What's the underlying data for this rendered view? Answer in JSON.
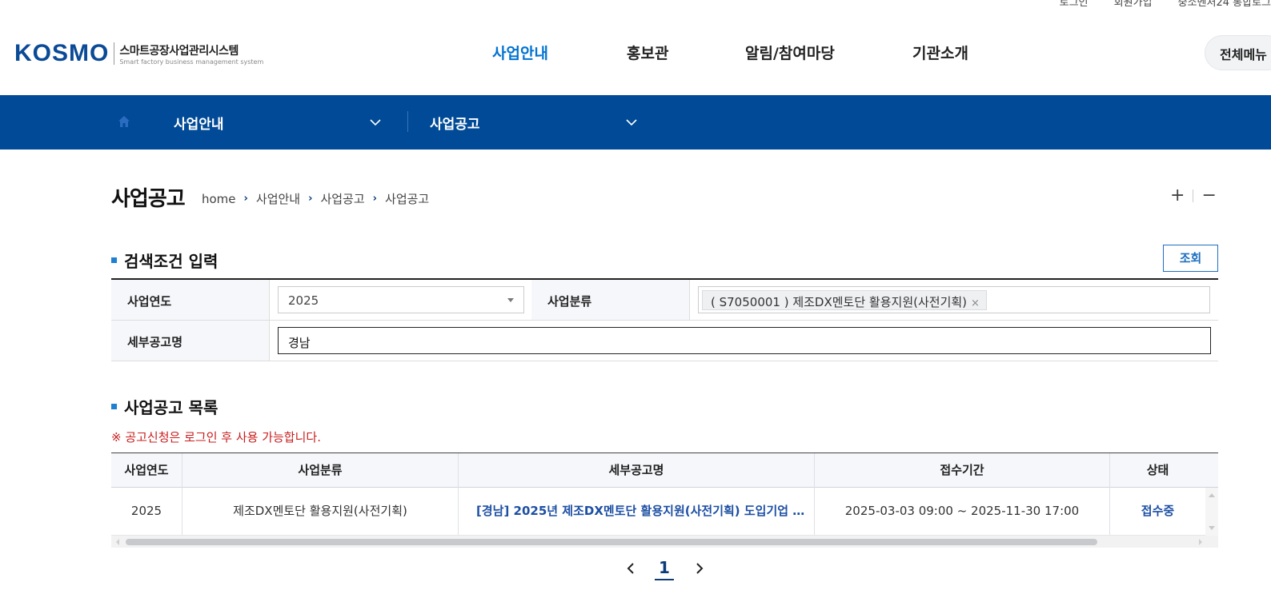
{
  "utility": {
    "items": [
      "로그인",
      "회원가입",
      "중소벤처24 통합로그"
    ]
  },
  "header": {
    "logo_text": "KOSMO",
    "logo_title": "스마트공장사업관리시스템",
    "logo_subtitle": "Smart factory business management system",
    "nav": [
      "사업안내",
      "홍보관",
      "알림/참여마당",
      "기관소개"
    ],
    "active_nav": "사업안내",
    "all_menu_label": "전체메뉴"
  },
  "subnav": {
    "menu1": "사업안내",
    "menu2": "사업공고"
  },
  "page": {
    "title": "사업공고",
    "breadcrumb": [
      "home",
      "사업안내",
      "사업공고",
      "사업공고"
    ],
    "zoom_in": "+",
    "zoom_out": "−"
  },
  "search": {
    "heading": "검색조건 입력",
    "button_label": "조회",
    "year_label": "사업연도",
    "year_value": "2025",
    "category_label": "사업분류",
    "category_tag": "( S7050001 ) 제조DX멘토단 활용지원(사전기획)",
    "tag_remove": "×",
    "title_label": "세부공고명",
    "title_value": "경남"
  },
  "list": {
    "heading": "사업공고 목록",
    "notice": "※ 공고신청은 로그인 후 사용 가능합니다.",
    "columns": [
      "사업연도",
      "사업분류",
      "세부공고명",
      "접수기간",
      "상태"
    ],
    "rows": [
      {
        "year": "2025",
        "category": "제조DX멘토단 활용지원(사전기획)",
        "title": "[경남] 2025년 제조DX멘토단 활용지원(사전기획) 도입기업 …",
        "period": "2025-03-03 09:00 ~ 2025-11-30 17:00",
        "status": "접수중"
      }
    ]
  },
  "pagination": {
    "current": "1"
  },
  "colors": {
    "brand_navy": "#004a97",
    "active_link": "#0072d0",
    "notice_red": "#c81e1e",
    "link_blue": "#1d4fa3"
  }
}
